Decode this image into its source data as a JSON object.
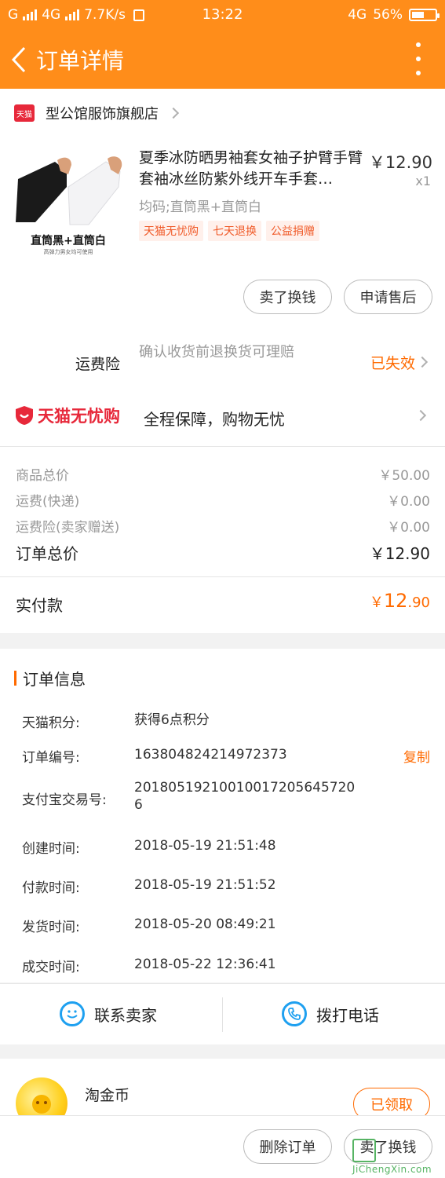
{
  "status_bar": {
    "carrier": "G",
    "network": "4G",
    "speed": "7.7K/s",
    "time": "13:22",
    "network_right": "4G",
    "battery": "56%"
  },
  "header": {
    "title": "订单详情"
  },
  "store": {
    "badge": "天猫",
    "name": "型公馆服饰旗舰店"
  },
  "product": {
    "title": "夏季冰防晒男袖套女袖子护臂手臂套袖冰丝防紫外线开车手套…",
    "price": "￥12.90",
    "quantity": "x1",
    "sku": "均码;直筒黑+直筒白",
    "tags": [
      "天猫无忧购",
      "七天退换",
      "公益捐赠"
    ],
    "image_caption": "直筒黑+直筒白",
    "image_subcaption": "高弹力男女均可使用"
  },
  "actions": {
    "resell": "卖了换钱",
    "after_sale": "申请售后"
  },
  "insurance": {
    "label": "运费险",
    "desc": "确认收货前退换货可理赔",
    "status": "已失效"
  },
  "wuyou": {
    "logo": "天猫无忧购",
    "text": "全程保障，购物无忧"
  },
  "price_breakdown": {
    "items": [
      {
        "label": "商品总价",
        "value": "￥50.00"
      },
      {
        "label": "运费(快递)",
        "value": "￥0.00"
      },
      {
        "label": "运费险(卖家赠送)",
        "value": "￥0.00"
      }
    ],
    "total_label": "订单总价",
    "total_value": "￥12.90",
    "paid_label": "实付款",
    "paid_currency": "￥",
    "paid_int": "12",
    "paid_dec": ".90"
  },
  "order_info": {
    "title": "订单信息",
    "rows": [
      {
        "label": "天猫积分:",
        "value": "获得6点积分"
      },
      {
        "label": "订单编号:",
        "value": "163804824214972373"
      },
      {
        "label": "支付宝交易号:",
        "value": "20180519210010017205645720"
      },
      {
        "label": "创建时间:",
        "value": "2018-05-19 21:51:48"
      },
      {
        "label": "付款时间:",
        "value": "2018-05-19 21:51:52"
      },
      {
        "label": "发货时间:",
        "value": "2018-05-20 08:49:21"
      },
      {
        "label": "成交时间:",
        "value": "2018-05-22 12:36:41"
      }
    ],
    "alipay_tail": "6",
    "copy_label": "复制"
  },
  "contact": {
    "seller": "联系卖家",
    "phone": "拨打电话"
  },
  "coins": {
    "title": "淘金币",
    "button": "已领取"
  },
  "bottom": {
    "delete": "删除订单",
    "resell": "卖了换钱"
  },
  "watermark": {
    "text": "JiChengXin.com"
  },
  "colors": {
    "header": "#ff8d1a",
    "accent": "#ff6a00",
    "tmall_red": "#e7283a"
  }
}
